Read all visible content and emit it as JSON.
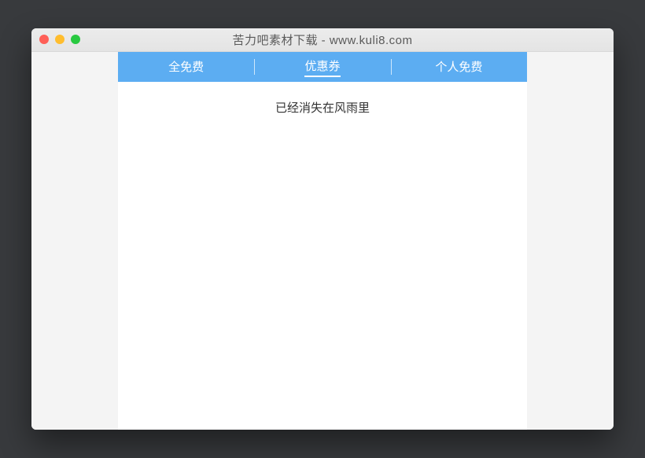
{
  "window": {
    "title": "苦力吧素材下载 - www.kuli8.com"
  },
  "tabs": [
    {
      "label": "全免费",
      "active": false
    },
    {
      "label": "优惠券",
      "active": true
    },
    {
      "label": "个人免费",
      "active": false
    }
  ],
  "content": {
    "text": "已经消失在风雨里"
  }
}
